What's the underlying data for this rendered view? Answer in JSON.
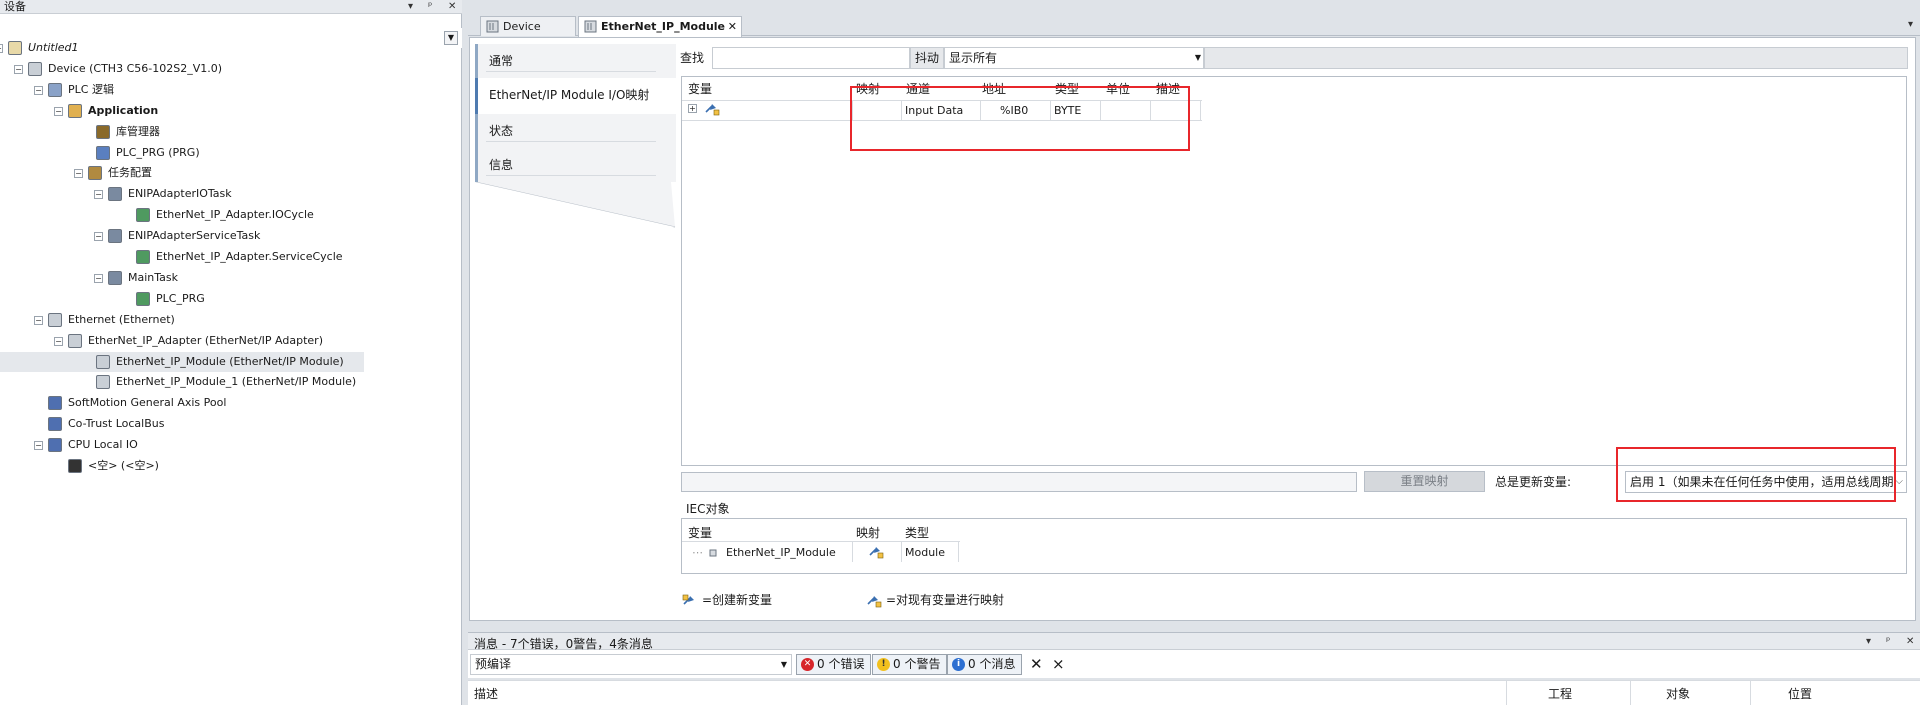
{
  "left_panel": {
    "title": "设备",
    "controls": [
      "▾",
      "ᵖ",
      "✕"
    ],
    "tree": [
      {
        "label": "Untitled1",
        "italic": true
      },
      {
        "label": "Device (CTH3 C56-102S2_V1.0)"
      },
      {
        "label": "PLC 逻辑"
      },
      {
        "label": "Application",
        "bold": true
      },
      {
        "label": "库管理器"
      },
      {
        "label": "PLC_PRG (PRG)"
      },
      {
        "label": "任务配置"
      },
      {
        "label": "ENIPAdapterIOTask"
      },
      {
        "label": "EtherNet_IP_Adapter.IOCycle"
      },
      {
        "label": "ENIPAdapterServiceTask"
      },
      {
        "label": "EtherNet_IP_Adapter.ServiceCycle"
      },
      {
        "label": "MainTask"
      },
      {
        "label": "PLC_PRG"
      },
      {
        "label": "Ethernet (Ethernet)"
      },
      {
        "label": "EtherNet_IP_Adapter (EtherNet/IP Adapter)"
      },
      {
        "label": "EtherNet_IP_Module (EtherNet/IP Module)",
        "selected": true
      },
      {
        "label": "EtherNet_IP_Module_1 (EtherNet/IP Module)"
      },
      {
        "label": "SoftMotion General Axis Pool"
      },
      {
        "label": "Co-Trust LocalBus"
      },
      {
        "label": "CPU Local IO"
      },
      {
        "label": "<空> (<空>)"
      }
    ]
  },
  "tabs": [
    {
      "label": "Device"
    },
    {
      "label": "EtherNet_IP_Module",
      "active": true
    }
  ],
  "side_nav": [
    {
      "label": "通常"
    },
    {
      "label": "EtherNet/IP Module I/O映射",
      "active": true
    },
    {
      "label": "状态"
    },
    {
      "label": "信息"
    }
  ],
  "search": {
    "label": "查找",
    "value": "",
    "filter_button": "抖动",
    "filter_value": "显示所有"
  },
  "io_grid": {
    "headers": [
      "变量",
      "映射",
      "通道",
      "地址",
      "类型",
      "单位",
      "描述"
    ],
    "rows": [
      {
        "variable": "",
        "mapping": "",
        "channel": "Input Data",
        "address": "%IB0",
        "type": "BYTE",
        "unit": "",
        "description": ""
      }
    ]
  },
  "reset_button": "重置映射",
  "always_update_label": "总是更新变量:",
  "always_update_value": "启用 1（如果未在任何任务中使用，适用总线周期",
  "iec": {
    "title": "IEC对象",
    "headers": [
      "变量",
      "映射",
      "类型"
    ],
    "rows": [
      {
        "variable": "EtherNet_IP_Module",
        "type": "Module"
      }
    ]
  },
  "legend": {
    "create": "=创建新变量",
    "map": "=对现有变量进行映射"
  },
  "messages": {
    "title": "消息 - 7个错误，0警告，4条消息",
    "filter": "预编译",
    "errors": "0 个错误",
    "warnings": "0 个警告",
    "infos": "0 个消息",
    "columns": [
      "描述",
      "工程",
      "对象",
      "位置"
    ]
  },
  "colors": {
    "highlight_box": "#e8262b",
    "accent": "#4f7bb0"
  }
}
